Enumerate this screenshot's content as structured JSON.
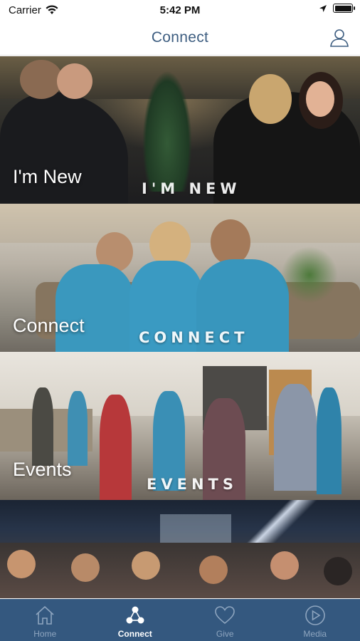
{
  "status_bar": {
    "carrier": "Carrier",
    "time": "5:42 PM"
  },
  "nav": {
    "title": "Connect",
    "profile_icon": "person-icon"
  },
  "tiles": [
    {
      "title": "I'm New",
      "watermark": "I'M NEW"
    },
    {
      "title": "Connect",
      "watermark": "CONNECT"
    },
    {
      "title": "Events",
      "watermark": "EVENTS"
    },
    {
      "title": "",
      "watermark": ""
    }
  ],
  "tab_bar": {
    "tabs": [
      {
        "label": "Home",
        "icon": "home-icon"
      },
      {
        "label": "Connect",
        "icon": "connect-icon"
      },
      {
        "label": "Give",
        "icon": "heart-icon"
      },
      {
        "label": "Media",
        "icon": "play-icon"
      }
    ],
    "active": "Connect",
    "background": "#34587f"
  },
  "colors": {
    "accent": "#3d5d80",
    "tab_active": "#ffffff",
    "tab_inactive": "#8ea5bf"
  }
}
